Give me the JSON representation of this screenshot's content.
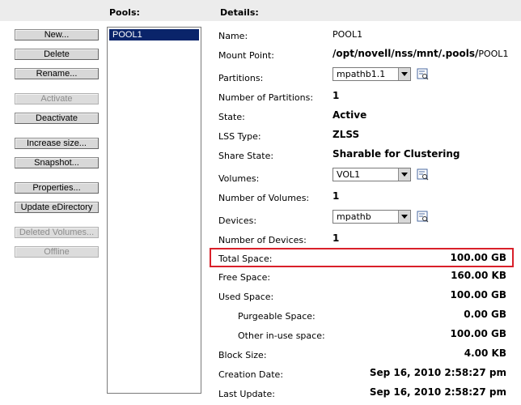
{
  "header": {
    "pools_title": "Pools:",
    "details_title": "Details:"
  },
  "buttons": {
    "new": "New...",
    "delete": "Delete",
    "rename": "Rename...",
    "activate": "Activate",
    "deactivate": "Deactivate",
    "increase_size": "Increase size...",
    "snapshot": "Snapshot...",
    "properties": "Properties...",
    "update_edirectory": "Update eDirectory",
    "deleted_volumes": "Deleted Volumes...",
    "offline": "Offline"
  },
  "pools": {
    "items": [
      "POOL1"
    ],
    "selected": "POOL1"
  },
  "details": {
    "name": {
      "label": "Name:",
      "value": "POOL1"
    },
    "mount_point": {
      "label": "Mount Point:",
      "value": "/opt/novell/nss/mnt/.pools/",
      "value_suffix": "POOL1"
    },
    "partitions": {
      "label": "Partitions:",
      "selected": "mpathb1.1"
    },
    "num_partitions": {
      "label": "Number of Partitions:",
      "value": "1"
    },
    "state": {
      "label": "State:",
      "value": "Active"
    },
    "lss_type": {
      "label": "LSS Type:",
      "value": "ZLSS"
    },
    "share_state": {
      "label": "Share State:",
      "value": "Sharable for Clustering"
    },
    "volumes": {
      "label": "Volumes:",
      "selected": "VOL1"
    },
    "num_volumes": {
      "label": "Number of Volumes:",
      "value": "1"
    },
    "devices": {
      "label": "Devices:",
      "selected": "mpathb"
    },
    "num_devices": {
      "label": "Number of Devices:",
      "value": "1"
    },
    "total_space": {
      "label": "Total Space:",
      "value": "100.00 GB"
    },
    "free_space": {
      "label": "Free Space:",
      "value": "160.00 KB"
    },
    "used_space": {
      "label": "Used Space:",
      "value": "100.00 GB"
    },
    "purgeable_space": {
      "label": "Purgeable Space:",
      "value": "0.00 GB"
    },
    "other_in_use": {
      "label": "Other in-use space:",
      "value": "100.00 GB"
    },
    "block_size": {
      "label": "Block Size:",
      "value": "4.00 KB"
    },
    "creation_date": {
      "label": "Creation Date:",
      "value": "Sep 16, 2010 2:58:27 pm"
    },
    "last_update": {
      "label": "Last Update:",
      "value": "Sep 16, 2010 2:58:27 pm"
    }
  },
  "colors": {
    "highlight": "#d9202a",
    "selection": "#0a246a",
    "header_bg": "#ececec"
  },
  "icons": {
    "properties": "properties-icon",
    "dropdown": "chevron-down-icon"
  }
}
